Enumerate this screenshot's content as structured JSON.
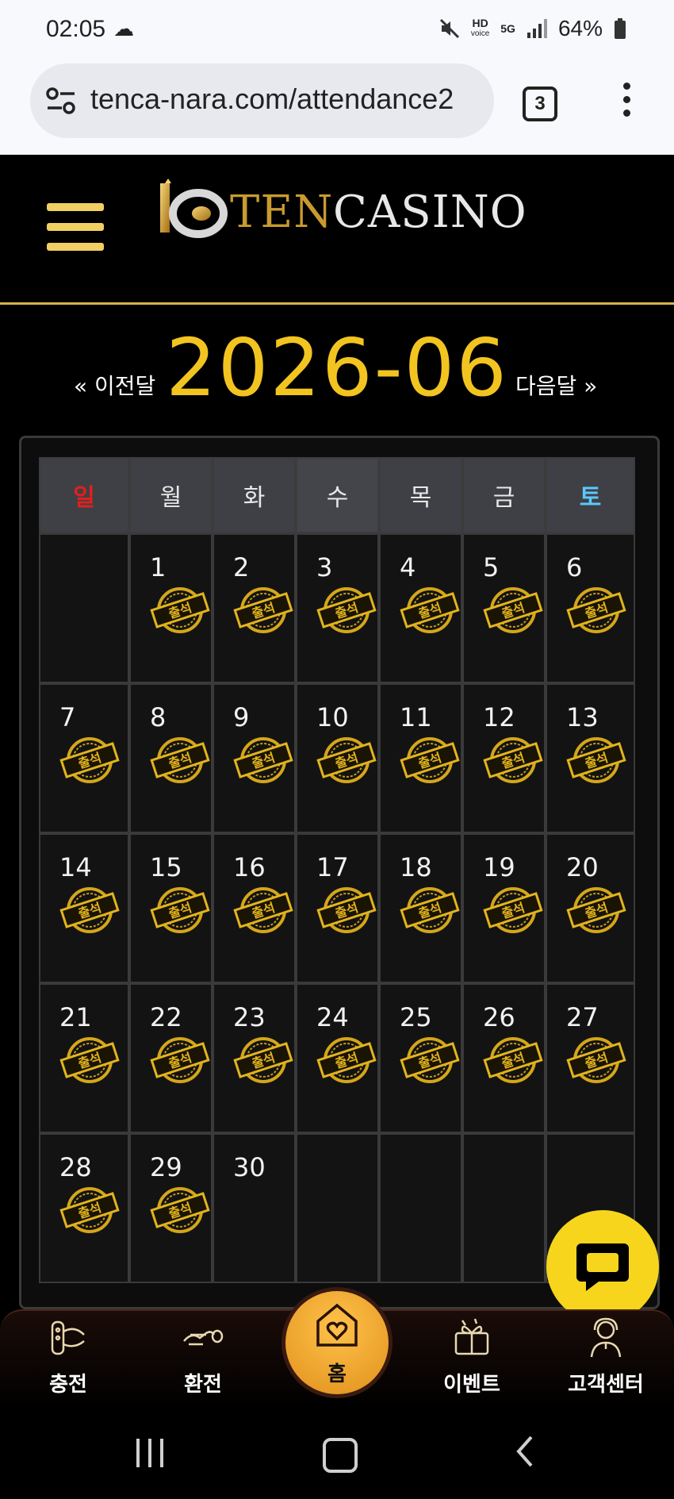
{
  "status_bar": {
    "time": "02:05",
    "net_top": "HD",
    "net_bottom": "voice",
    "gen": "5G",
    "battery": "64%"
  },
  "browser": {
    "url": "tenca-nara.com/attendance2",
    "tab_count": "3"
  },
  "site": {
    "logo_ten": "TEN",
    "logo_casino": "CASINO"
  },
  "month_nav": {
    "prev_label": "« 이전달",
    "title": "2026-06",
    "next_label": "다음달 »"
  },
  "calendar": {
    "weekdays": [
      "일",
      "월",
      "화",
      "수",
      "목",
      "금",
      "토"
    ],
    "stamp_text": "출석",
    "weeks": [
      [
        {
          "day": ""
        },
        {
          "day": "1",
          "stamp": true
        },
        {
          "day": "2",
          "stamp": true
        },
        {
          "day": "3",
          "stamp": true
        },
        {
          "day": "4",
          "stamp": true
        },
        {
          "day": "5",
          "stamp": true
        },
        {
          "day": "6",
          "stamp": true
        }
      ],
      [
        {
          "day": "7",
          "stamp": true
        },
        {
          "day": "8",
          "stamp": true
        },
        {
          "day": "9",
          "stamp": true
        },
        {
          "day": "10",
          "stamp": true
        },
        {
          "day": "11",
          "stamp": true
        },
        {
          "day": "12",
          "stamp": true
        },
        {
          "day": "13",
          "stamp": true
        }
      ],
      [
        {
          "day": "14",
          "stamp": true
        },
        {
          "day": "15",
          "stamp": true
        },
        {
          "day": "16",
          "stamp": true
        },
        {
          "day": "17",
          "stamp": true
        },
        {
          "day": "18",
          "stamp": true
        },
        {
          "day": "19",
          "stamp": true
        },
        {
          "day": "20",
          "stamp": true
        }
      ],
      [
        {
          "day": "21",
          "stamp": true
        },
        {
          "day": "22",
          "stamp": true
        },
        {
          "day": "23",
          "stamp": true
        },
        {
          "day": "24",
          "stamp": true
        },
        {
          "day": "25",
          "stamp": true
        },
        {
          "day": "26",
          "stamp": true
        },
        {
          "day": "27",
          "stamp": true
        }
      ],
      [
        {
          "day": "28",
          "stamp": true
        },
        {
          "day": "29",
          "stamp": true
        },
        {
          "day": "30",
          "stamp": false
        },
        {
          "day": ""
        },
        {
          "day": ""
        },
        {
          "day": ""
        },
        {
          "day": ""
        }
      ]
    ]
  },
  "bottom_nav": {
    "deposit": "충전",
    "withdraw": "환전",
    "home": "홈",
    "event": "이벤트",
    "support": "고객센터"
  },
  "colors": {
    "accent_gold": "#f2c420",
    "sunday_red": "#e0201c",
    "saturday_blue": "#5ac8ff",
    "chat_yellow": "#f6d51c"
  },
  "icons": [
    "moon-cloud-icon",
    "mute-icon",
    "signal-icon",
    "battery-icon",
    "tune-icon",
    "hamburger-icon",
    "chat-bubble-icon",
    "deposit-icon",
    "withdraw-icon",
    "home-heart-icon",
    "gift-icon",
    "support-agent-icon"
  ]
}
